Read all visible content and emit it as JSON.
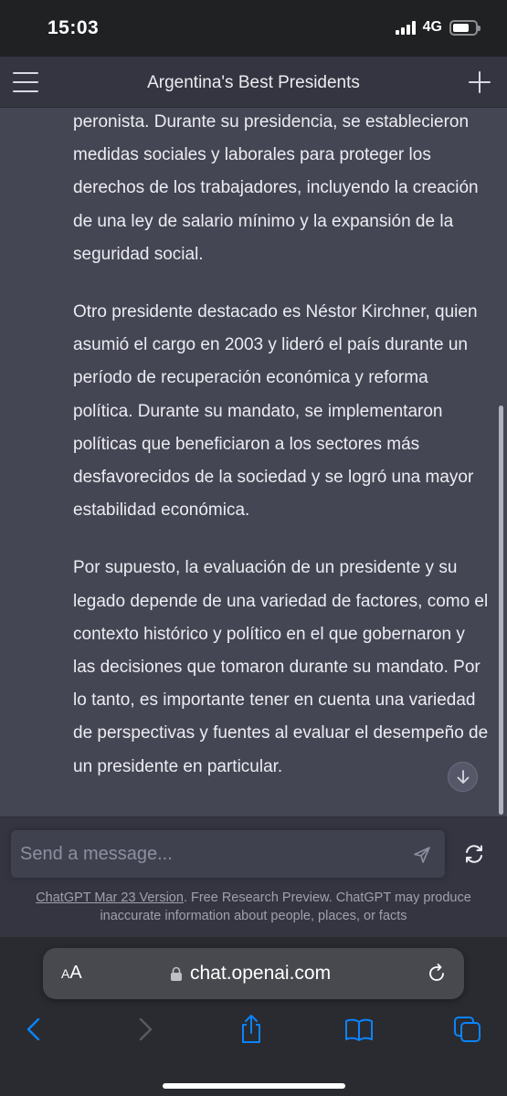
{
  "status_bar": {
    "time": "15:03",
    "network": "4G"
  },
  "header": {
    "title": "Argentina's Best Presidents"
  },
  "conversation": {
    "paragraphs": [
      "peronista. Durante su presidencia, se establecieron medidas sociales y laborales para proteger los derechos de los trabajadores, incluyendo la creación de una ley de salario mínimo y la expansión de la seguridad social.",
      "Otro presidente destacado es Néstor Kirchner, quien asumió el cargo en 2003 y lideró el país durante un período de recuperación económica y reforma política. Durante su mandato, se implementaron políticas que beneficiaron a los sectores más desfavorecidos de la sociedad y se logró una mayor estabilidad económica.",
      "Por supuesto, la evaluación de un presidente y su legado depende de una variedad de factores, como el contexto histórico y político en el que gobernaron y las decisiones que tomaron durante su mandato. Por lo tanto, es importante tener en cuenta una variedad de perspectivas y fuentes al evaluar el desempeño de un presidente en particular."
    ]
  },
  "composer": {
    "placeholder": "Send a message..."
  },
  "disclaimer": {
    "version_link": "ChatGPT Mar 23 Version",
    "text": ". Free Research Preview. ChatGPT may produce inaccurate information about people, places, or facts"
  },
  "browser": {
    "aa_small": "A",
    "aa_large": "A",
    "url": "chat.openai.com"
  },
  "icons": {
    "menu": "hamburger-menu-icon",
    "new_chat": "plus-icon",
    "send": "send-icon",
    "regenerate": "regenerate-icon",
    "scroll_down": "arrow-down-icon",
    "lock": "lock-icon",
    "reload": "reload-icon",
    "back": "chevron-left-icon",
    "forward": "chevron-right-icon",
    "share": "share-icon",
    "bookmarks": "book-icon",
    "tabs": "tabs-icon"
  },
  "colors": {
    "accent_blue": "#0a84ff",
    "page_bg": "#343541",
    "message_bg": "#444654"
  }
}
